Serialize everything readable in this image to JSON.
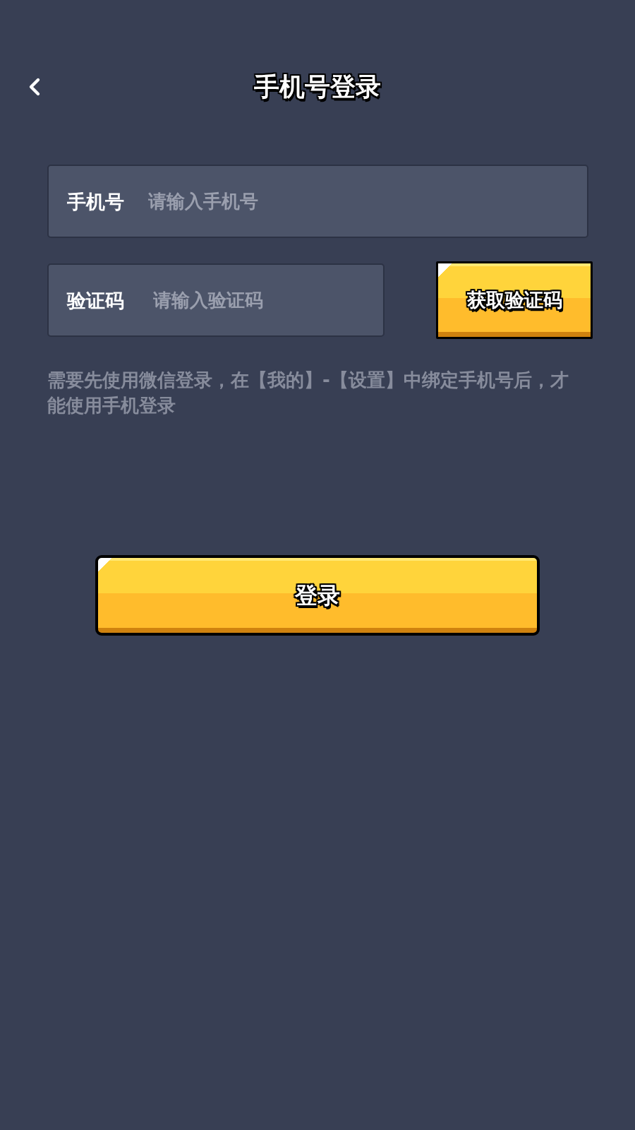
{
  "header": {
    "title": "手机号登录"
  },
  "phone_field": {
    "label": "手机号",
    "placeholder": "请输入手机号"
  },
  "code_field": {
    "label": "验证码",
    "placeholder": "请输入验证码",
    "action": "获取验证码"
  },
  "hint": "需要先使用微信登录，在【我的】-【设置】中绑定手机号后，才能使用手机登录",
  "login_button": "登录"
}
